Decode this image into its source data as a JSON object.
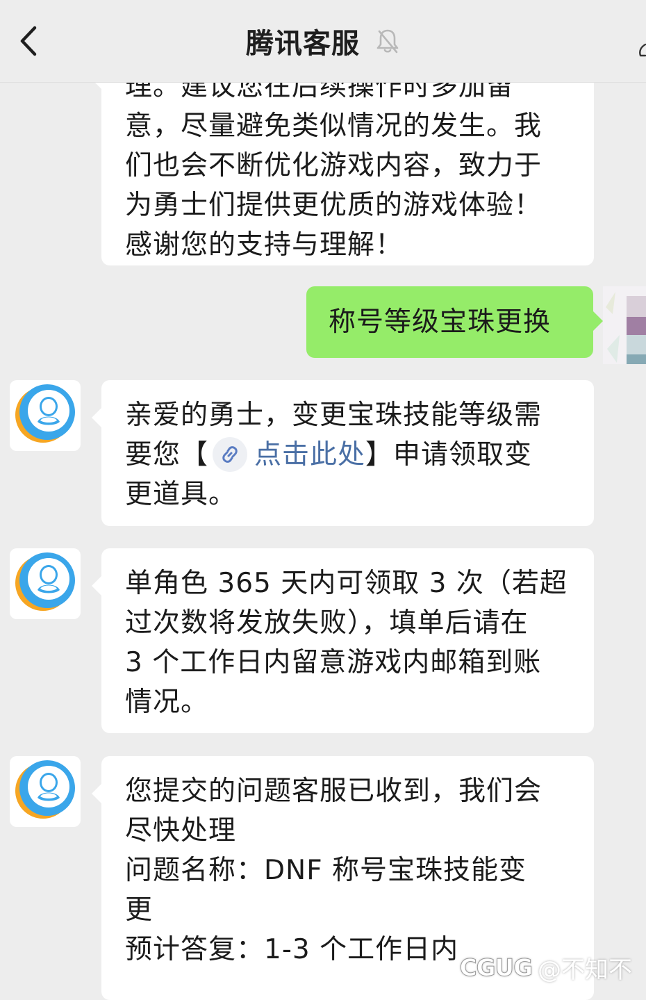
{
  "header": {
    "title": "腾讯客服",
    "back_icon": "chevron-left-icon",
    "mute_icon": "bell-muted-icon"
  },
  "messages": [
    {
      "id": "m1",
      "side": "incoming",
      "lines": [
        "理。建议您在后续操作时多加留",
        "意，尽量避免类似情况的发生。我",
        "们也会不断优化游戏内容，致力于",
        "为勇士们提供更优质的游戏体验！",
        "感谢您的支持与理解！"
      ]
    },
    {
      "id": "m2",
      "side": "outgoing",
      "text": "称号等级宝珠更换"
    },
    {
      "id": "m3",
      "side": "incoming",
      "line1": "亲爱的勇士，变更宝珠技能等级需",
      "line2_before": "要您【",
      "link_text": "点击此处",
      "line2_after": "】申请领取变",
      "line3": "更道具。"
    },
    {
      "id": "m4",
      "side": "incoming",
      "lines": [
        "单角色 365 天内可领取 3 次（若超",
        "过次数将发放失败），填单后请在",
        "3 个工作日内留意游戏内邮箱到账",
        "情况。"
      ]
    },
    {
      "id": "m5",
      "side": "incoming",
      "lines": [
        "您提交的问题客服已收到，我们会",
        "尽快处理",
        "问题名称：DNF 称号宝珠技能变",
        "更",
        "预计答复：1-3 个工作日内"
      ]
    }
  ],
  "watermark": {
    "logo": "CGUG",
    "handle": "@不知不"
  },
  "colors": {
    "background": "#ededed",
    "outgoing_bubble": "#95ec69",
    "incoming_bubble": "#ffffff",
    "link": "#4a6fa5"
  }
}
